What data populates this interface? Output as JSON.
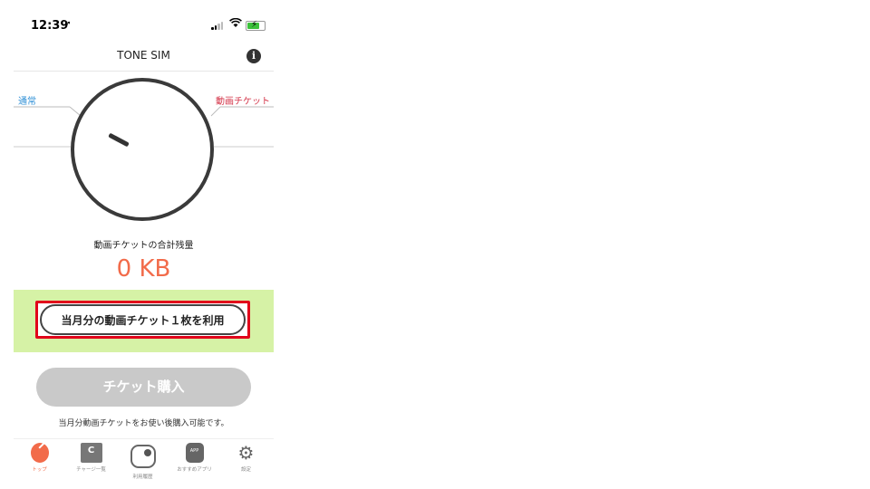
{
  "status_bar": {
    "time": "12:39",
    "location_icon": "location-arrow-icon",
    "wifi_icon": "wifi-icon",
    "battery_icon": "battery-charging-icon"
  },
  "navbar": {
    "title": "TONE SIM",
    "info_icon": "i"
  },
  "dial": {
    "left_label": "通常",
    "right_label": "動画チケット",
    "remaining_label": "動画チケットの合計残量",
    "remaining_value": "0 KB"
  },
  "actions": {
    "use_ticket_label": "当月分の動画チケット１枚を利用",
    "buy_ticket_label": "チケット購入",
    "buy_note": "当月分動画チケットをお使い後購入可能です。"
  },
  "tabs": [
    {
      "label": "トップ",
      "icon": "dial-icon",
      "active": true
    },
    {
      "label": "チャージ一覧",
      "icon": "charge-icon",
      "glyph": "C",
      "active": false
    },
    {
      "label": "利用履歴",
      "icon": "toggle-icon",
      "active": false
    },
    {
      "label": "おすすめアプリ",
      "icon": "app-icon",
      "glyph": "APP",
      "active": false
    },
    {
      "label": "設定",
      "icon": "gear-icon",
      "glyph": "⚙",
      "active": false
    }
  ],
  "colors": {
    "accent": "#f26b4a",
    "normal_label": "#2e8fd6",
    "ticket_label": "#d4364a",
    "band": "#d6f2a6",
    "highlight": "#e1001a"
  }
}
